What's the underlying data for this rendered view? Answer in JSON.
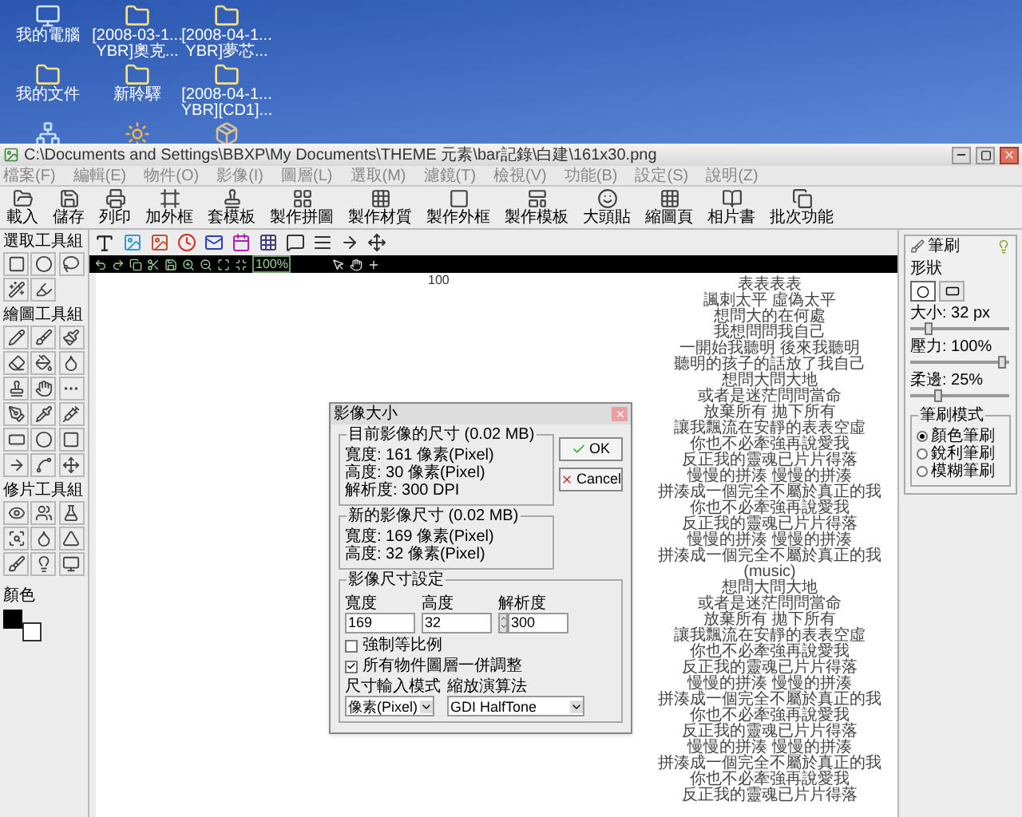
{
  "desktop": {
    "icons": [
      {
        "kind": "computer",
        "lines": [
          "我的電腦"
        ]
      },
      {
        "kind": "folder",
        "lines": [
          "[2008-03-1...",
          "YBR]奧克..."
        ]
      },
      {
        "kind": "folder",
        "lines": [
          "[2008-04-1...",
          "YBR]夢芯..."
        ]
      },
      {
        "kind": "folder",
        "lines": [
          "我的文件"
        ]
      },
      {
        "kind": "folder",
        "lines": [
          "新聆驛"
        ]
      },
      {
        "kind": "folder",
        "lines": [
          "[2008-04-1...",
          "YBR][CD1]..."
        ]
      },
      {
        "kind": "network"
      },
      {
        "kind": "image"
      },
      {
        "kind": "box"
      }
    ]
  },
  "window": {
    "title": "C:\\Documents and Settings\\BBXP\\My Documents\\THEME 元素\\bar記錄\\白建\\161x30.png",
    "menu": [
      "檔案(F)",
      "編輯(E)",
      "物件(O)",
      "影像(I)",
      "圖層(L)",
      "選取(M)",
      "濾鏡(T)",
      "檢視(V)",
      "功能(B)",
      "設定(S)",
      "說明(Z)"
    ],
    "toolbar": [
      "載入",
      "儲存",
      "列印",
      "加外框",
      "套模板",
      "製作拼圖",
      "製作材質",
      "製作外框",
      "製作模板",
      "大頭貼",
      "縮圖頁",
      "相片書",
      "批次功能"
    ]
  },
  "tool_groups": [
    {
      "title": "選取工具組"
    },
    {
      "title": "繪圖工具組"
    },
    {
      "title": "修片工具組"
    }
  ],
  "color_label": "顏色",
  "zoom_label": "100%",
  "ruler_label": "100",
  "brush_panel": {
    "title": "筆刷",
    "shape_label": "形狀",
    "shapes": [
      {
        "kind": "circle",
        "selected": true
      },
      {
        "kind": "rect",
        "selected": false
      }
    ],
    "sliders": [
      {
        "label": "大小: 32 px",
        "level": 0.18
      },
      {
        "label": "壓力: 100%",
        "level": 0.92
      },
      {
        "label": "柔邊: 25%",
        "level": 0.28
      }
    ],
    "mode_title": "筆刷模式",
    "modes": [
      {
        "label": "顏色筆刷",
        "selected": true
      },
      {
        "label": "銳利筆刷",
        "selected": false
      },
      {
        "label": "模糊筆刷",
        "selected": false
      }
    ]
  },
  "dialog": {
    "title": "影像大小",
    "current": {
      "title": "目前影像的尺寸 (0.02 MB)",
      "lines": [
        "寬度: 161 像素(Pixel)",
        "高度: 30 像素(Pixel)",
        "解析度: 300 DPI"
      ]
    },
    "new": {
      "title": "新的影像尺寸 (0.02 MB)",
      "lines": [
        "寬度: 169 像素(Pixel)",
        "高度: 32 像素(Pixel)"
      ]
    },
    "buttons": [
      {
        "kind": "ok",
        "label": "OK"
      },
      {
        "kind": "cancel",
        "label": "Cancel"
      }
    ],
    "settings": {
      "title": "影像尺寸設定",
      "fields": [
        {
          "label": "寬度",
          "value": "169"
        },
        {
          "label": "高度",
          "value": "32"
        },
        {
          "label": "解析度",
          "value": "300",
          "spinner": true
        }
      ],
      "checks": [
        {
          "label": "強制等比例",
          "checked": false
        },
        {
          "label": "所有物件圖層一併調整",
          "checked": true
        }
      ],
      "selects": [
        {
          "label": "尺寸輸入模式",
          "value": "像素(Pixel)"
        },
        {
          "label": "縮放演算法",
          "value": "GDI HalfTone"
        }
      ]
    }
  },
  "lyrics": [
    "表表表表",
    "諷刺太平 虛偽太平",
    "想問大的在何處",
    "我想問問我自己",
    "一開始我聽明 後來我聽明",
    "聽明的孩子的話放了我自己",
    "想問大問大地",
    "或者是迷茫問問當命",
    "放棄所有 拋下所有",
    "讓我飄流在安靜的表表空虛",
    "你也不必牽強再說愛我",
    "反正我的靈魂已片片得落",
    "慢慢的拼湊 慢慢的拼湊",
    "拼湊成一個完全不屬於真正的我",
    "你也不必牽強再說愛我",
    "反正我的靈魂已片片得落",
    "慢慢的拼湊 慢慢的拼湊",
    "拼湊成一個完全不屬於真正的我",
    "(music)",
    "想問大問大地",
    "或者是迷茫問問當命",
    "放棄所有 拋下所有",
    "讓我飄流在安靜的表表空虛",
    "你也不必牽強再說愛我",
    "反正我的靈魂已片片得落",
    "慢慢的拼湊 慢慢的拼湊",
    "拼湊成一個完全不屬於真正的我",
    "你也不必牽強再說愛我",
    "反正我的靈魂已片片得落",
    "慢慢的拼湊 慢慢的拼湊",
    "拼湊成一個完全不屬於真正的我",
    "你也不必牽強再說愛我",
    "反正我的靈魂已片片得落"
  ]
}
